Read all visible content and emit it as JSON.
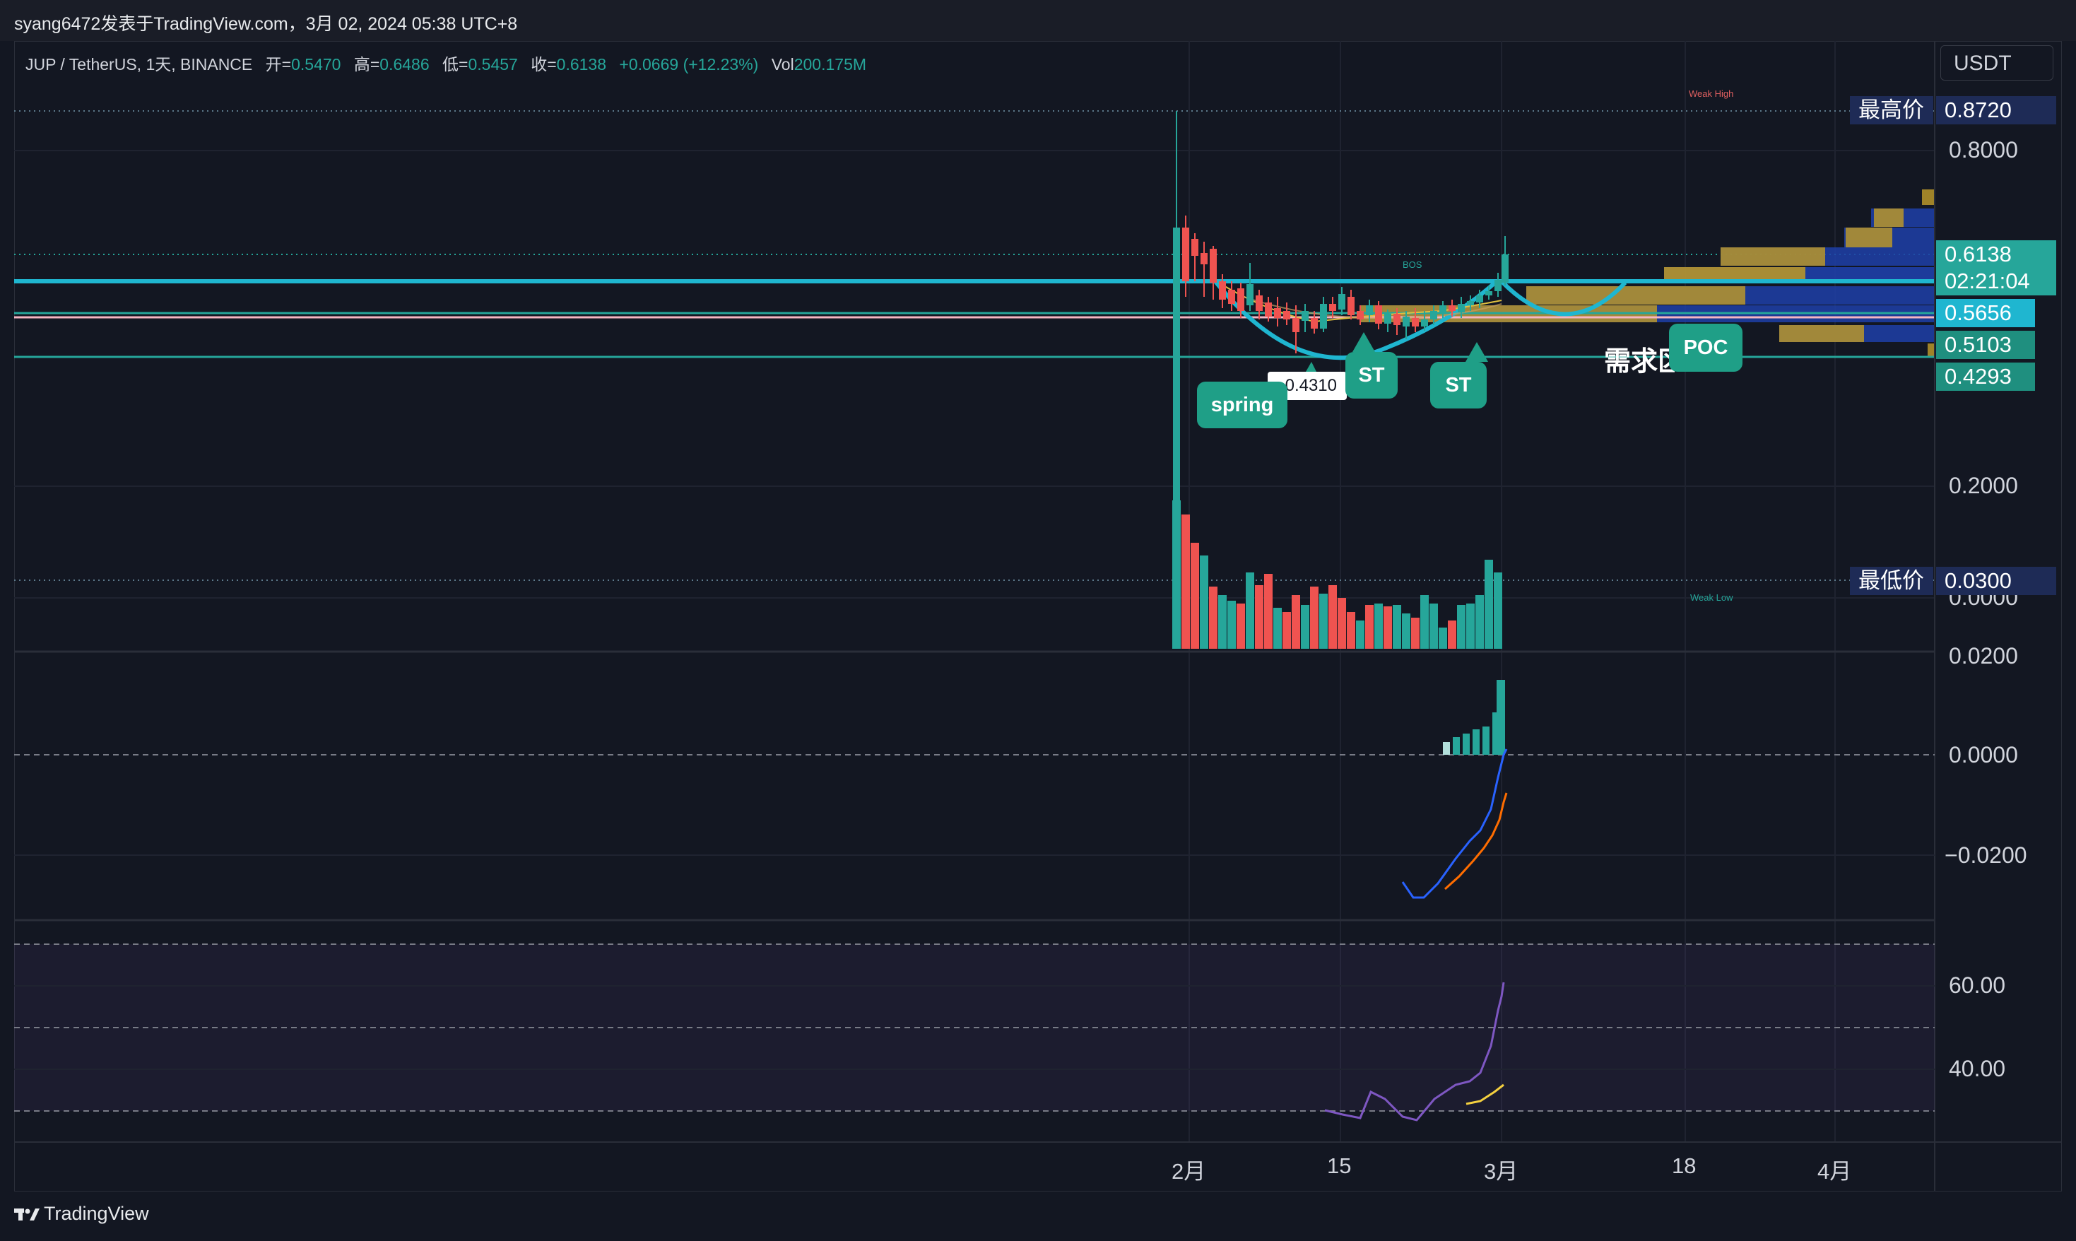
{
  "attribution": "syang6472发表于TradingView.com，3月 02, 2024 05:38 UTC+8",
  "legend": {
    "symbol": "JUP / TetherUS, 1天, BINANCE",
    "open_label": "开=",
    "open": "0.5470",
    "high_label": "高=",
    "high": "0.6486",
    "low_label": "低=",
    "low": "0.5457",
    "close_label": "收=",
    "close": "0.6138",
    "change": "+0.0669 (+12.23%)",
    "vol_label": "Vol",
    "vol": "200.175M"
  },
  "currency_button": "USDT",
  "price_axis": {
    "ticks": [
      "0.8000",
      "0.2000",
      "0.0000"
    ],
    "tags": {
      "high_label": "最高价",
      "high_value": "0.8720",
      "last_price": "0.6138",
      "countdown": "02:21:04",
      "level_1": "0.5656",
      "level_2": "0.5103",
      "level_3": "0.4293",
      "low_label": "最低价",
      "low_value": "0.0300"
    }
  },
  "macd_axis": {
    "ticks": [
      "0.0200",
      "0.0000",
      "−0.0200"
    ]
  },
  "rsi_axis": {
    "ticks": [
      "60.00",
      "40.00"
    ]
  },
  "time_axis": {
    "labels": [
      "2月",
      "15",
      "3月",
      "18",
      "4月"
    ]
  },
  "annotations": {
    "spring": "spring",
    "st_1": "ST",
    "st_2": "ST",
    "poc": "POC",
    "demand_zone": "需求区",
    "price_note": "0.4310",
    "bos": "BOS",
    "weak_high": "Weak High",
    "weak_low": "Weak Low"
  },
  "footer": {
    "brand": "TradingView"
  },
  "colors": {
    "up": "#26a69a",
    "down": "#ef5350",
    "accent_cyan": "#1fb6d0",
    "label_navy": "#1e2b56",
    "bubble_green": "#1f9f87",
    "vp_gold": "#b8962a",
    "vp_blue": "#1f3fa8"
  }
}
